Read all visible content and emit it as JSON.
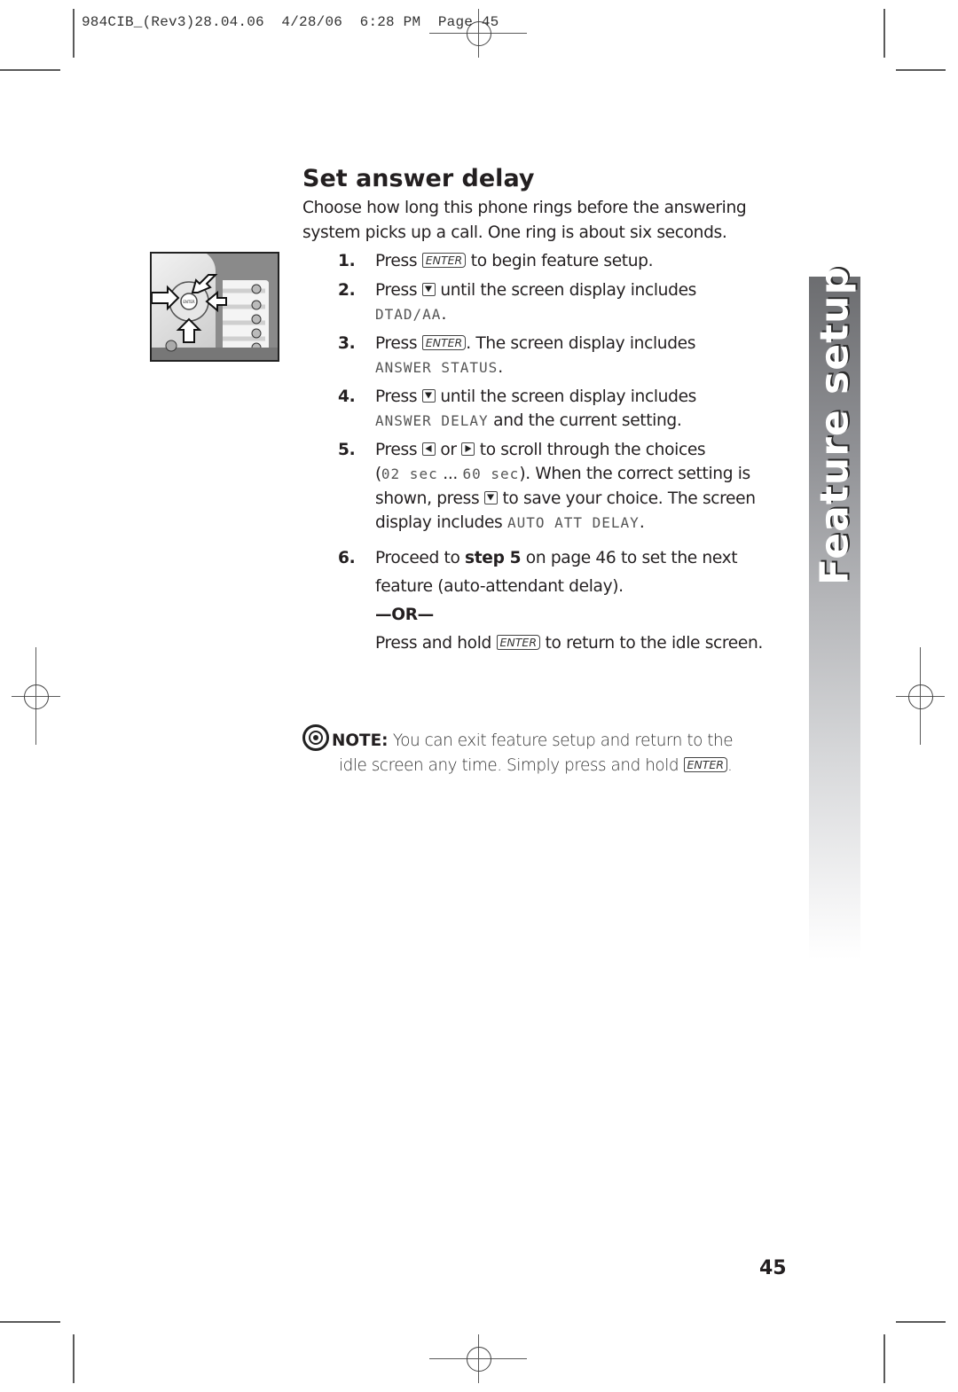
{
  "slug": {
    "text": "984CIB_(Rev3)28.04.06  4/28/06  6:28 PM  Page 45"
  },
  "side_tab": {
    "label": "Feature setup"
  },
  "section": {
    "title": "Set answer delay",
    "intro": "Choose how long this phone rings before the answering system picks up a call.  One ring is about six seconds."
  },
  "keys": {
    "enter": "ENTER",
    "down_icon": "down-arrow-key-icon",
    "left_icon": "left-arrow-key-icon",
    "right_icon": "right-arrow-key-icon"
  },
  "steps": [
    {
      "num": "1.",
      "before": "Press",
      "after": "to begin feature setup."
    },
    {
      "num": "2.",
      "before": "Press",
      "after": "until the screen display includes",
      "lcd": "DTAD/AA",
      "end": "."
    },
    {
      "num": "3.",
      "before": "Press",
      "after": ". The screen display includes",
      "lcd": "ANSWER STATUS",
      "end": "."
    },
    {
      "num": "4.",
      "before": "Press",
      "after": "until the screen display includes",
      "lcd": "ANSWER DELAY",
      "end": "and the current setting."
    },
    {
      "num": "5.",
      "before": "Press",
      "or": "or",
      "after": "to scroll through the choices",
      "paren_open": "(",
      "lcd_min": "02 sec",
      "ellipsis": "...",
      "lcd_max": "60 sec",
      "paren_close": "). When the correct setting is shown, press",
      "save": "to save your choice. The screen display includes",
      "lcd": "AUTO ATT DELAY",
      "end": "."
    },
    {
      "num": "6.",
      "text_a": "Proceed to",
      "bold": "step 5",
      "text_b": "on page 46 to set the next feature (auto-attendant delay).",
      "or_label": "—OR—",
      "alt_before": "Press and hold",
      "alt_after": "to return to the idle screen."
    }
  ],
  "note": {
    "icon": "target-note-icon",
    "label": "NOTE:",
    "text": "You can exit feature setup and return to the",
    "line2": "idle screen any time.  Simply press and hold",
    "end": "."
  },
  "page_number": "45",
  "phone_illustration": {
    "center_key": "ENTER",
    "description": "phone keypad navigation with arrows pointing to enter and arrow keys"
  }
}
